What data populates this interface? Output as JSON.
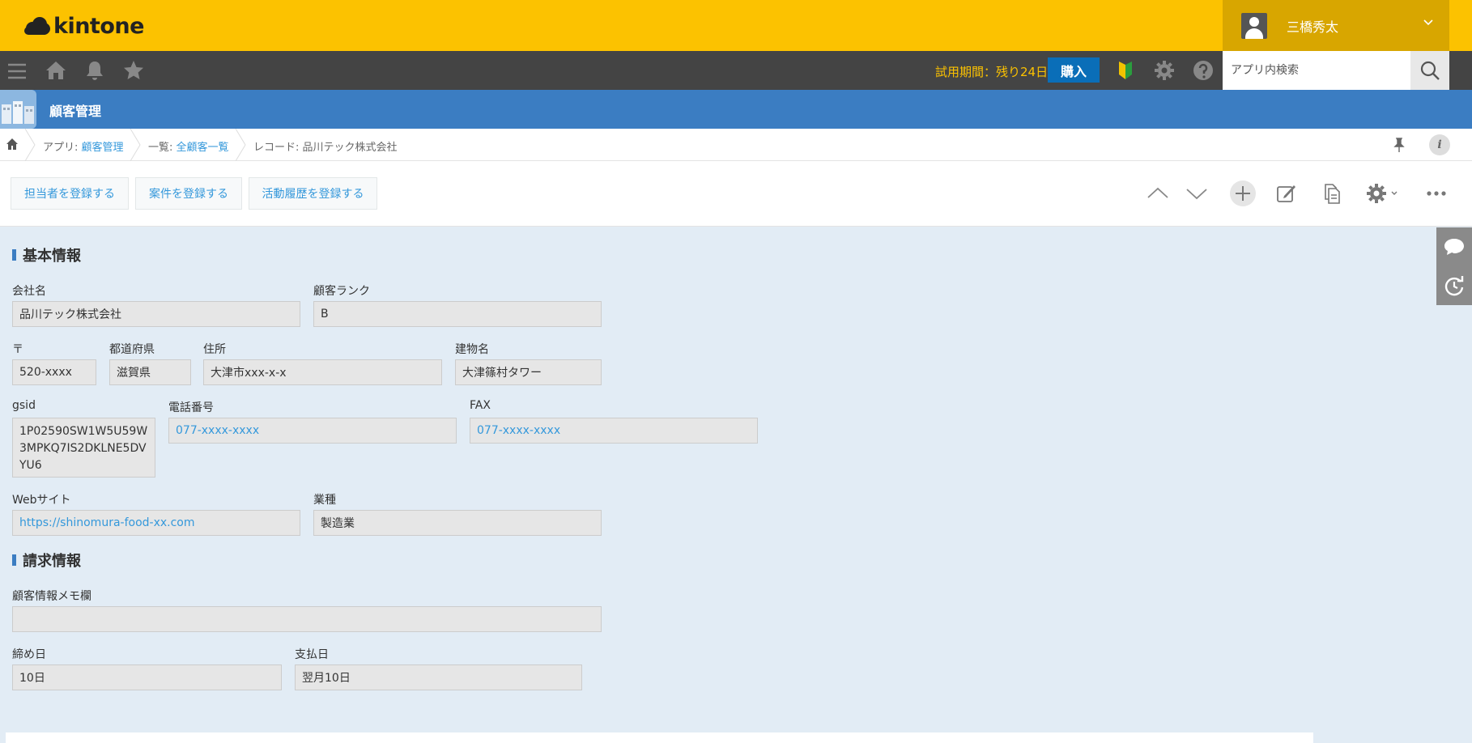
{
  "header": {
    "logo_text": "kintone",
    "user_name": "三橋秀太"
  },
  "toolbar": {
    "trial_text": "試用期間：残り24日",
    "buy_label": "購入",
    "search_placeholder": "アプリ内検索"
  },
  "app": {
    "title": "顧客管理"
  },
  "breadcrumb": {
    "app_prefix": "アプリ: ",
    "app_link": "顧客管理",
    "list_prefix": "一覧: ",
    "list_link": "全顧客一覧",
    "record_text": "レコード: 品川テック株式会社",
    "info_label": "i"
  },
  "actions": {
    "btn1": "担当者を登録する",
    "btn2": "案件を登録する",
    "btn3": "活動履歴を登録する"
  },
  "form": {
    "section1": "基本情報",
    "company_label": "会社名",
    "company_value": "品川テック株式会社",
    "rank_label": "顧客ランク",
    "rank_value": "B",
    "zip_label": "〒",
    "zip_value": "520-xxxx",
    "pref_label": "都道府県",
    "pref_value": "滋賀県",
    "address_label": "住所",
    "address_value": "大津市xxx-x-x",
    "building_label": "建物名",
    "building_value": "大津篠村タワー",
    "gsid_label": "gsid",
    "gsid_value": "1P02590SW1W5U59W3MPKQ7IS2DKLNE5DVYU6",
    "phone_label": "電話番号",
    "phone_value": "077-xxxx-xxxx",
    "fax_label": "FAX",
    "fax_value": "077-xxxx-xxxx",
    "web_label": "Webサイト",
    "web_value": "https://shinomura-food-xx.com",
    "industry_label": "業種",
    "industry_value": "製造業",
    "section2": "請求情報",
    "memo_label": "顧客情報メモ欄",
    "memo_value": "",
    "closing_label": "締め日",
    "closing_value": "10日",
    "payment_label": "支払日",
    "payment_value": "翌月10日"
  },
  "colors": {
    "header": "#fcc200",
    "toolbar": "#444444",
    "appbar": "#3b7dc2",
    "link": "#3498db",
    "background": "#e2ecf5"
  }
}
